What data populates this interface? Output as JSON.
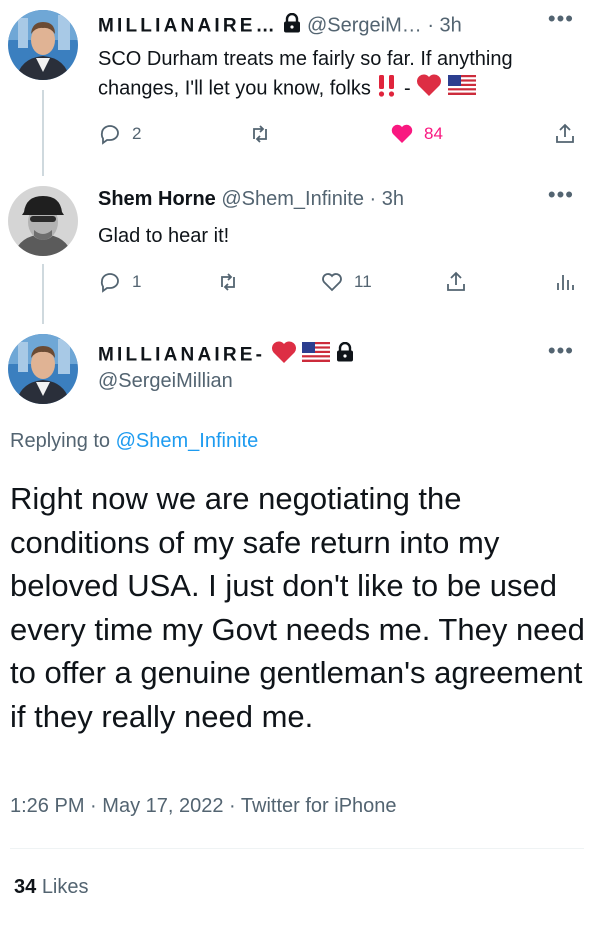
{
  "tweet1": {
    "display_name": "MILLIANAIRE…",
    "handle": "@SergeiM…",
    "time": "· 3h",
    "text_line1": "SCO Durham treats me fairly so far. If anything",
    "text_line2": "changes, I'll let you know, folks",
    "text_tail": " - ",
    "replies": "2",
    "likes": "84"
  },
  "tweet2": {
    "display_name": "Shem Horne",
    "handle": "@Shem_Infinite",
    "time": "· 3h",
    "text": "Glad to hear it!",
    "replies": "1",
    "likes": "11"
  },
  "main_tweet": {
    "display_name": "MILLIANAIRE-",
    "handle": "@SergeiMillian",
    "replying_prefix": "Replying to",
    "replying_to": "@Shem_Infinite",
    "text": "Right now we are negotiating the conditions of my safe return into my beloved USA. I just don't like to be used every time my Govt needs me. They need to offer a genuine gentleman's agreement if they really need me.",
    "time": "1:26 PM",
    "date": "May 17, 2022",
    "source": "Twitter for iPhone",
    "like_count": "34",
    "like_label": "Likes"
  },
  "colors": {
    "like_active": "#f91880",
    "link": "#1d9bf0",
    "secondary_text": "#536471"
  },
  "icons": [
    "lock-icon",
    "heart-emoji",
    "us-flag-emoji",
    "double-exclamation-emoji",
    "reply-icon",
    "retweet-icon",
    "like-icon",
    "share-icon",
    "analytics-icon",
    "more-icon"
  ]
}
